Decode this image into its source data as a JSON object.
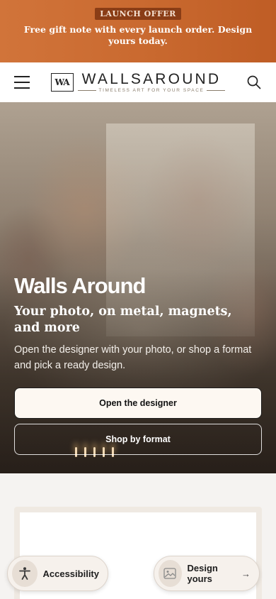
{
  "announcement": {
    "badge": "LAUNCH OFFER",
    "message": "Free gift note with every launch order. Design yours today."
  },
  "header": {
    "logo_mark": "WA",
    "logo_name": "WALLSAROUND",
    "logo_tagline": "TIMELESS ART FOR YOUR SPACE"
  },
  "hero": {
    "title": "Walls Around",
    "subtitle": "Your photo, on metal, magnets, and more",
    "description": "Open the designer with your photo, or shop a format and pick a ready design.",
    "primary_button": "Open the designer",
    "secondary_button": "Shop by format"
  },
  "floating": {
    "accessibility_label": "Accessibility",
    "design_label": "Design yours",
    "design_arrow": "→"
  },
  "colors": {
    "announcement_bg": "#c9692f",
    "badge_bg": "#8a3d16",
    "primary_button_bg": "#fdf8f2"
  }
}
